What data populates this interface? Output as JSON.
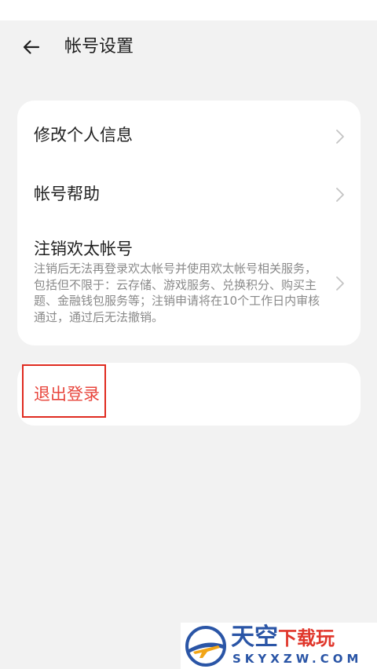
{
  "header": {
    "title": "帐号设置",
    "back_icon": "arrow-left-icon"
  },
  "settings": {
    "items": [
      {
        "label": "修改个人信息"
      },
      {
        "label": "帐号帮助"
      },
      {
        "label": "注销欢太帐号",
        "description": "注销后无法再登录欢太帐号并使用欢太帐号相关服务，包括但不限于：云存储、游戏服务、兑换积分、购买主题、金融钱包服务等；注销申请将在10个工作日内审核通过，通过后无法撤销。"
      }
    ],
    "logout_label": "退出登录"
  },
  "colors": {
    "background": "#f2f2f2",
    "card": "#ffffff",
    "logout_text": "#e8453c",
    "highlight_border": "#e02b20",
    "description_text": "#8a8a8a"
  },
  "watermark": {
    "name_main": "天空",
    "name_sub": "下载玩",
    "domain": "SKYXZW.COM"
  }
}
